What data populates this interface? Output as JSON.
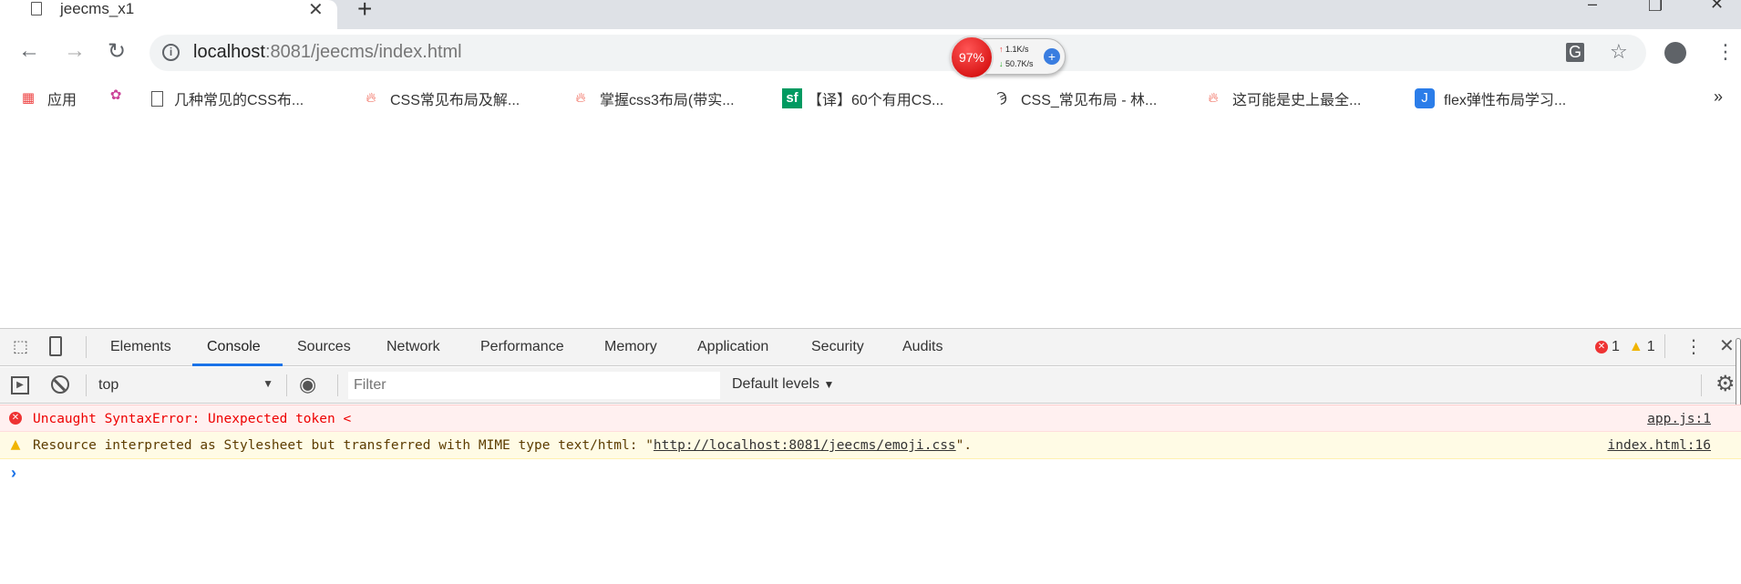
{
  "browser": {
    "tab_title": "jeecms_x1",
    "url_host": "localhost",
    "url_rest": ":8081/jeecms/index.html",
    "speed_widget": {
      "percent": "97%",
      "upload": "1.1K/s",
      "download": "50.7K/s"
    }
  },
  "bookmarks": [
    {
      "label": "应用",
      "icon": "apps-grid-icon"
    },
    {
      "label": "",
      "icon": "site-logo-icon"
    },
    {
      "label": "几种常见的CSS布...",
      "icon": "page-icon"
    },
    {
      "label": "CSS常见布局及解...",
      "icon": "flame-icon"
    },
    {
      "label": "掌握css3布局(带实...",
      "icon": "flame-icon"
    },
    {
      "label": "【译】60个有用CS...",
      "icon": "sf-icon"
    },
    {
      "label": "CSS_常见布局 - 林...",
      "icon": "site-logo-icon"
    },
    {
      "label": "这可能是史上最全...",
      "icon": "flame-icon"
    },
    {
      "label": "flex弹性布局学习...",
      "icon": "site-logo-icon"
    }
  ],
  "bookmarks_more": "»",
  "devtools": {
    "tabs": [
      "Elements",
      "Console",
      "Sources",
      "Network",
      "Performance",
      "Memory",
      "Application",
      "Security",
      "Audits"
    ],
    "active_tab": "Console",
    "error_count": "1",
    "warning_count": "1",
    "context": "top",
    "filter_placeholder": "Filter",
    "levels": "Default levels",
    "colors": {
      "error_bg": "#fff0f0",
      "warning_bg": "#fffbe5",
      "accent": "#1a73e8"
    }
  },
  "console": {
    "error": {
      "message": "Uncaught SyntaxError: Unexpected token <",
      "source": "app.js:1"
    },
    "warning": {
      "message_before": "Resource interpreted as Stylesheet but transferred with MIME type text/html: \"",
      "link": "http://localhost:8081/jeecms/emoji.css",
      "message_after": "\".",
      "source": "index.html:16"
    },
    "prompt": "›"
  }
}
